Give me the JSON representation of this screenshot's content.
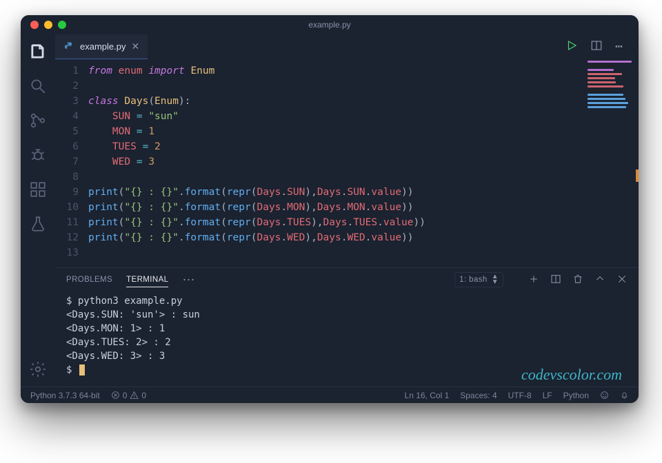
{
  "title": "example.py",
  "colors": {
    "bg": "#1b2230"
  },
  "tab": {
    "label": "example.py"
  },
  "code": {
    "lines": [
      {
        "n": 1,
        "tokens": [
          [
            "kw",
            "from"
          ],
          [
            "",
            ""
          ],
          [
            "var",
            "enum"
          ],
          [
            "",
            ""
          ],
          [
            "kw",
            "import"
          ],
          [
            "",
            ""
          ],
          [
            "fn",
            "Enum"
          ]
        ]
      },
      {
        "n": 2,
        "tokens": []
      },
      {
        "n": 3,
        "tokens": [
          [
            "kw",
            "class"
          ],
          [
            "",
            ""
          ],
          [
            "fn",
            "Days"
          ],
          [
            "pun",
            "("
          ],
          [
            "fn",
            "Enum"
          ],
          [
            "pun",
            ")"
          ],
          [
            "pun",
            ":"
          ]
        ]
      },
      {
        "n": 4,
        "tokens": [
          [
            "",
            "    "
          ],
          [
            "var",
            "SUN"
          ],
          [
            "",
            ""
          ],
          [
            "op",
            "="
          ],
          [
            "",
            ""
          ],
          [
            "str",
            "\"sun\""
          ]
        ]
      },
      {
        "n": 5,
        "tokens": [
          [
            "",
            "    "
          ],
          [
            "var",
            "MON"
          ],
          [
            "",
            ""
          ],
          [
            "op",
            "="
          ],
          [
            "",
            ""
          ],
          [
            "num",
            "1"
          ]
        ]
      },
      {
        "n": 6,
        "tokens": [
          [
            "",
            "    "
          ],
          [
            "var",
            "TUES"
          ],
          [
            "",
            ""
          ],
          [
            "op",
            "="
          ],
          [
            "",
            ""
          ],
          [
            "num",
            "2"
          ]
        ]
      },
      {
        "n": 7,
        "tokens": [
          [
            "",
            "    "
          ],
          [
            "var",
            "WED"
          ],
          [
            "",
            ""
          ],
          [
            "op",
            "="
          ],
          [
            "",
            ""
          ],
          [
            "num",
            "3"
          ]
        ]
      },
      {
        "n": 8,
        "tokens": []
      },
      {
        "n": 9,
        "tokens": [
          [
            "fn2",
            "print"
          ],
          [
            "pun",
            "("
          ],
          [
            "str",
            "\"{} : {}\""
          ],
          [
            "dot",
            "."
          ],
          [
            "fn2",
            "format"
          ],
          [
            "pun",
            "("
          ],
          [
            "fn2",
            "repr"
          ],
          [
            "pun",
            "("
          ],
          [
            "var",
            "Days"
          ],
          [
            "dot",
            "."
          ],
          [
            "attr",
            "SUN"
          ],
          [
            "pun",
            ")"
          ],
          [
            "pun",
            ","
          ],
          [
            "var",
            "Days"
          ],
          [
            "dot",
            "."
          ],
          [
            "attr",
            "SUN"
          ],
          [
            "dot",
            "."
          ],
          [
            "attr",
            "value"
          ],
          [
            "pun",
            ")"
          ],
          [
            "pun",
            ")"
          ]
        ]
      },
      {
        "n": 10,
        "tokens": [
          [
            "fn2",
            "print"
          ],
          [
            "pun",
            "("
          ],
          [
            "str",
            "\"{} : {}\""
          ],
          [
            "dot",
            "."
          ],
          [
            "fn2",
            "format"
          ],
          [
            "pun",
            "("
          ],
          [
            "fn2",
            "repr"
          ],
          [
            "pun",
            "("
          ],
          [
            "var",
            "Days"
          ],
          [
            "dot",
            "."
          ],
          [
            "attr",
            "MON"
          ],
          [
            "pun",
            ")"
          ],
          [
            "pun",
            ","
          ],
          [
            "var",
            "Days"
          ],
          [
            "dot",
            "."
          ],
          [
            "attr",
            "MON"
          ],
          [
            "dot",
            "."
          ],
          [
            "attr",
            "value"
          ],
          [
            "pun",
            ")"
          ],
          [
            "pun",
            ")"
          ]
        ]
      },
      {
        "n": 11,
        "tokens": [
          [
            "fn2",
            "print"
          ],
          [
            "pun",
            "("
          ],
          [
            "str",
            "\"{} : {}\""
          ],
          [
            "dot",
            "."
          ],
          [
            "fn2",
            "format"
          ],
          [
            "pun",
            "("
          ],
          [
            "fn2",
            "repr"
          ],
          [
            "pun",
            "("
          ],
          [
            "var",
            "Days"
          ],
          [
            "dot",
            "."
          ],
          [
            "attr",
            "TUES"
          ],
          [
            "pun",
            ")"
          ],
          [
            "pun",
            ","
          ],
          [
            "var",
            "Days"
          ],
          [
            "dot",
            "."
          ],
          [
            "attr",
            "TUES"
          ],
          [
            "dot",
            "."
          ],
          [
            "attr",
            "value"
          ],
          [
            "pun",
            ")"
          ],
          [
            "pun",
            ")"
          ]
        ]
      },
      {
        "n": 12,
        "tokens": [
          [
            "fn2",
            "print"
          ],
          [
            "pun",
            "("
          ],
          [
            "str",
            "\"{} : {}\""
          ],
          [
            "dot",
            "."
          ],
          [
            "fn2",
            "format"
          ],
          [
            "pun",
            "("
          ],
          [
            "fn2",
            "repr"
          ],
          [
            "pun",
            "("
          ],
          [
            "var",
            "Days"
          ],
          [
            "dot",
            "."
          ],
          [
            "attr",
            "WED"
          ],
          [
            "pun",
            ")"
          ],
          [
            "pun",
            ","
          ],
          [
            "var",
            "Days"
          ],
          [
            "dot",
            "."
          ],
          [
            "attr",
            "WED"
          ],
          [
            "dot",
            "."
          ],
          [
            "attr",
            "value"
          ],
          [
            "pun",
            ")"
          ],
          [
            "pun",
            ")"
          ]
        ]
      },
      {
        "n": 13,
        "tokens": []
      }
    ]
  },
  "panel": {
    "tabs": {
      "problems": "PROBLEMS",
      "terminal": "TERMINAL"
    },
    "terminal_selector": "1: bash",
    "terminal_lines": [
      "$ python3 example.py",
      "<Days.SUN: 'sun'> : sun",
      "<Days.MON: 1> : 1",
      "<Days.TUES: 2> : 2",
      "<Days.WED: 3> : 3",
      "$ "
    ]
  },
  "status": {
    "python": "Python 3.7.3 64-bit",
    "errors": "0",
    "warnings": "0",
    "cursor": "Ln 16, Col 1",
    "spaces": "Spaces: 4",
    "encoding": "UTF-8",
    "eol": "LF",
    "lang": "Python"
  },
  "watermark": "codevscolor.com"
}
